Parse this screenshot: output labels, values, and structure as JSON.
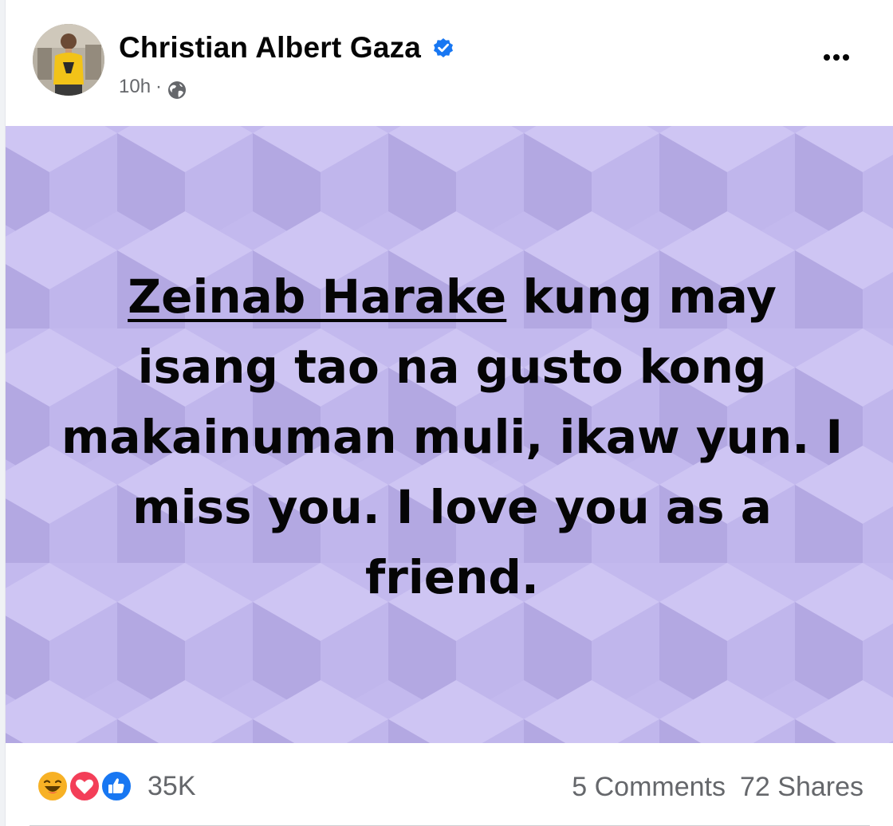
{
  "post": {
    "author": {
      "name": "Christian Albert Gaza",
      "verified_icon": "verified-badge-icon",
      "avatar_icon": "avatar-photo"
    },
    "meta": {
      "timestamp": "10h",
      "separator": "·",
      "audience_icon": "globe-icon"
    },
    "more_icon": "more-options-icon",
    "background": {
      "color": "#c3b9ee",
      "pattern": "isometric cubes"
    },
    "text": {
      "mention": "Zeinab Harake",
      "body": " kung may isang tao na gusto kong makainuman muli, ikaw yun. I miss you. I love you as a friend."
    },
    "stats": {
      "reaction_icons": [
        "haha-icon",
        "love-icon",
        "like-icon"
      ],
      "reaction_count": "35K",
      "comments": "5 Comments",
      "shares": "72 Shares"
    }
  },
  "colors": {
    "text": "#050505",
    "secondary": "#65676b",
    "accent": "#1877f2",
    "love": "#f33e58",
    "haha": "#f7b125"
  }
}
